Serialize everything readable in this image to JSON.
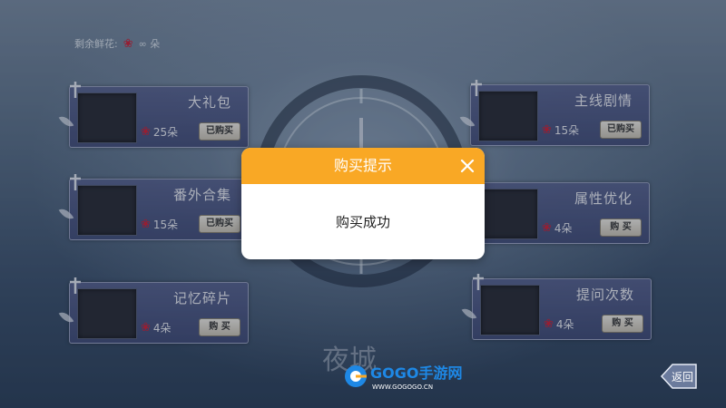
{
  "header": {
    "remaining_label": "剩余鲜花:",
    "remaining_value": "∞ 朵"
  },
  "cards": [
    {
      "title": "大礼包",
      "price": "25朵",
      "button": "已购买"
    },
    {
      "title": "主线剧情",
      "price": "15朵",
      "button": "已购买"
    },
    {
      "title": "番外合集",
      "price": "15朵",
      "button": "已购买"
    },
    {
      "title": "属性优化",
      "price": "4朵",
      "button": "购 买"
    },
    {
      "title": "记忆碎片",
      "price": "4朵",
      "button": "购 买"
    },
    {
      "title": "提问次数",
      "price": "4朵",
      "button": "购 买"
    }
  ],
  "modal": {
    "title": "购买提示",
    "message": "购买成功"
  },
  "back_button": {
    "label": "返回"
  },
  "watermark": {
    "brand": "GOGO手游网",
    "url": "WWW.GOGOGO.CN"
  },
  "logo_text": "夜城",
  "colors": {
    "modal_header": "#f9a825",
    "card_bg": "#5c6694",
    "rose": "#d2243a"
  }
}
